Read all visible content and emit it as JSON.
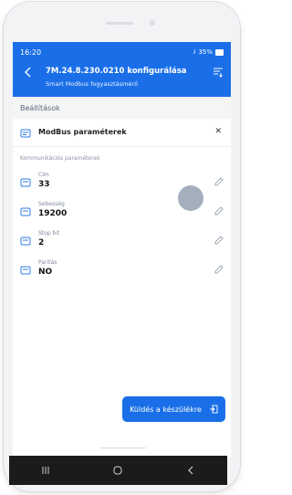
{
  "status": {
    "time": "16:20",
    "battery": "35%"
  },
  "header": {
    "title": "7M.24.8.230.0210 konfigurálása",
    "subtitle": "Smart Modbus fogyasztásmérő"
  },
  "section": {
    "title": "Beállítások"
  },
  "panel": {
    "title": "ModBus paraméterek",
    "group_label": "Kommunikációs paraméterek",
    "params": [
      {
        "label": "Cím",
        "value": "33"
      },
      {
        "label": "Sebesség",
        "value": "19200"
      },
      {
        "label": "Stop bit",
        "value": "2"
      },
      {
        "label": "Paritás",
        "value": "NO"
      }
    ]
  },
  "actions": {
    "send_label": "Küldés a készülékre"
  },
  "icons": {
    "back": "back-arrow-icon",
    "filter": "filter-list-icon",
    "close": "close-icon",
    "param": "device-icon",
    "edit": "edit-icon",
    "send": "exit-to-icon"
  },
  "colors": {
    "primary": "#1a6fe8",
    "navbar": "#1b1b1b"
  }
}
